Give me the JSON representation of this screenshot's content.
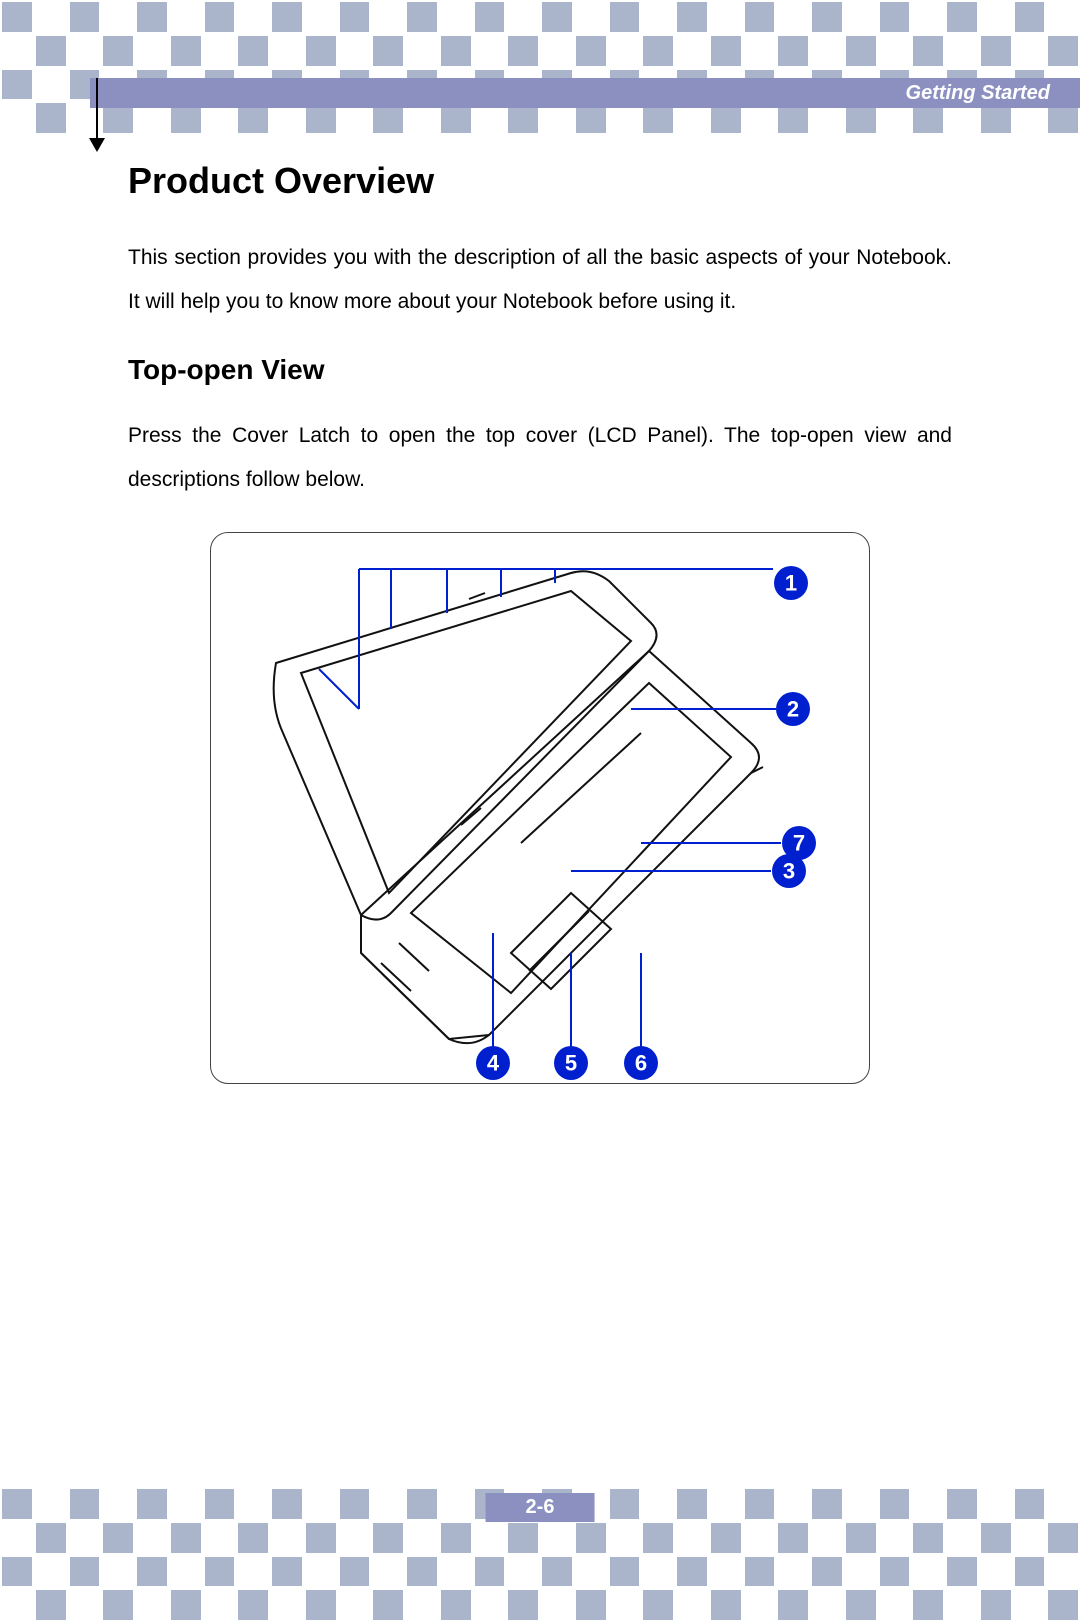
{
  "header": {
    "section": "Getting Started"
  },
  "title": "Product Overview",
  "intro": "This section provides you with the description of all the basic aspects of your Notebook.   It will help you to know more about your Notebook before using it.",
  "subtitle": "Top-open View",
  "topopen_para": "Press the Cover Latch to open the top cover (LCD Panel). The top-open view and descriptions follow below.",
  "callouts": {
    "c1": "1",
    "c2": "2",
    "c3": "3",
    "c4": "4",
    "c5": "5",
    "c6": "6",
    "c7": "7"
  },
  "page_number": "2-6"
}
